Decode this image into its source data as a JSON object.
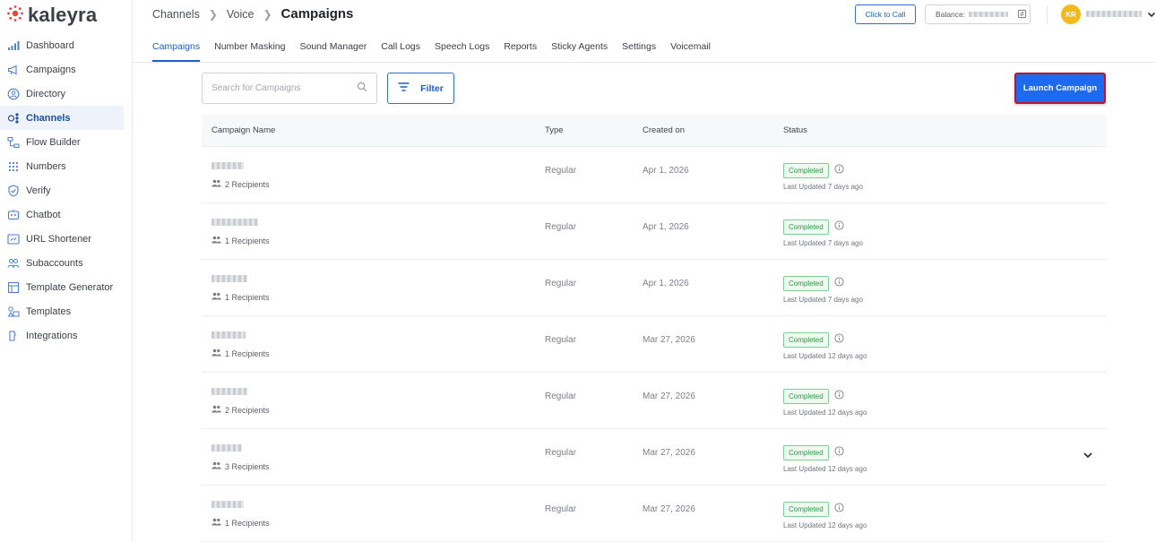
{
  "brand": {
    "name": "kaleyra",
    "accent": "#1b6af0",
    "logo_color": "#e2453a"
  },
  "sidebar": {
    "items": [
      {
        "label": "Dashboard",
        "icon": "bar-chart-icon",
        "active": false
      },
      {
        "label": "Campaigns",
        "icon": "megaphone-icon",
        "active": false
      },
      {
        "label": "Directory",
        "icon": "contact-circle-icon",
        "active": false
      },
      {
        "label": "Channels",
        "icon": "channels-icon",
        "active": true
      },
      {
        "label": "Flow Builder",
        "icon": "flow-builder-icon",
        "active": false
      },
      {
        "label": "Numbers",
        "icon": "keypad-icon",
        "active": false
      },
      {
        "label": "Verify",
        "icon": "shield-check-icon",
        "active": false
      },
      {
        "label": "Chatbot",
        "icon": "chatbot-icon",
        "active": false
      },
      {
        "label": "URL Shortener",
        "icon": "link-icon",
        "active": false
      },
      {
        "label": "Subaccounts",
        "icon": "users-icon",
        "active": false
      },
      {
        "label": "Template Generator",
        "icon": "template-generator-icon",
        "active": false
      },
      {
        "label": "Templates",
        "icon": "templates-icon",
        "active": false
      },
      {
        "label": "Integrations",
        "icon": "puzzle-icon",
        "active": false
      }
    ]
  },
  "header": {
    "breadcrumb": [
      "Channels",
      "Voice"
    ],
    "current": "Campaigns",
    "click_to_call": "Click to Call",
    "balance_label": "Balance:",
    "avatar_initials": "KR"
  },
  "tabs": [
    {
      "label": "Campaigns",
      "active": true
    },
    {
      "label": "Number Masking",
      "active": false
    },
    {
      "label": "Sound Manager",
      "active": false
    },
    {
      "label": "Call Logs",
      "active": false
    },
    {
      "label": "Speech Logs",
      "active": false
    },
    {
      "label": "Reports",
      "active": false
    },
    {
      "label": "Sticky Agents",
      "active": false
    },
    {
      "label": "Settings",
      "active": false
    },
    {
      "label": "Voicemail",
      "active": false
    }
  ],
  "toolbar": {
    "search_placeholder": "Search for Campaigns",
    "filter_label": "Filter",
    "launch_label": "Launch Campaign"
  },
  "table": {
    "columns": [
      "Campaign Name",
      "Type",
      "Created on",
      "Status"
    ],
    "rows": [
      {
        "recipients": "2 Recipients",
        "type": "Regular",
        "created": "Apr 1, 2026",
        "status": "Completed",
        "updated": "Last Updated 7 days ago",
        "expandable": false
      },
      {
        "recipients": "1 Recipients",
        "type": "Regular",
        "created": "Apr 1, 2026",
        "status": "Completed",
        "updated": "Last Updated 7 days ago",
        "expandable": false
      },
      {
        "recipients": "1 Recipients",
        "type": "Regular",
        "created": "Apr 1, 2026",
        "status": "Completed",
        "updated": "Last Updated 7 days ago",
        "expandable": false
      },
      {
        "recipients": "1 Recipients",
        "type": "Regular",
        "created": "Mar 27, 2026",
        "status": "Completed",
        "updated": "Last Updated 12 days ago",
        "expandable": false
      },
      {
        "recipients": "2 Recipients",
        "type": "Regular",
        "created": "Mar 27, 2026",
        "status": "Completed",
        "updated": "Last Updated 12 days ago",
        "expandable": false
      },
      {
        "recipients": "3 Recipients",
        "type": "Regular",
        "created": "Mar 27, 2026",
        "status": "Completed",
        "updated": "Last Updated 12 days ago",
        "expandable": true
      },
      {
        "recipients": "1 Recipients",
        "type": "Regular",
        "created": "Mar 27, 2026",
        "status": "Completed",
        "updated": "Last Updated 12 days ago",
        "expandable": false
      }
    ]
  }
}
